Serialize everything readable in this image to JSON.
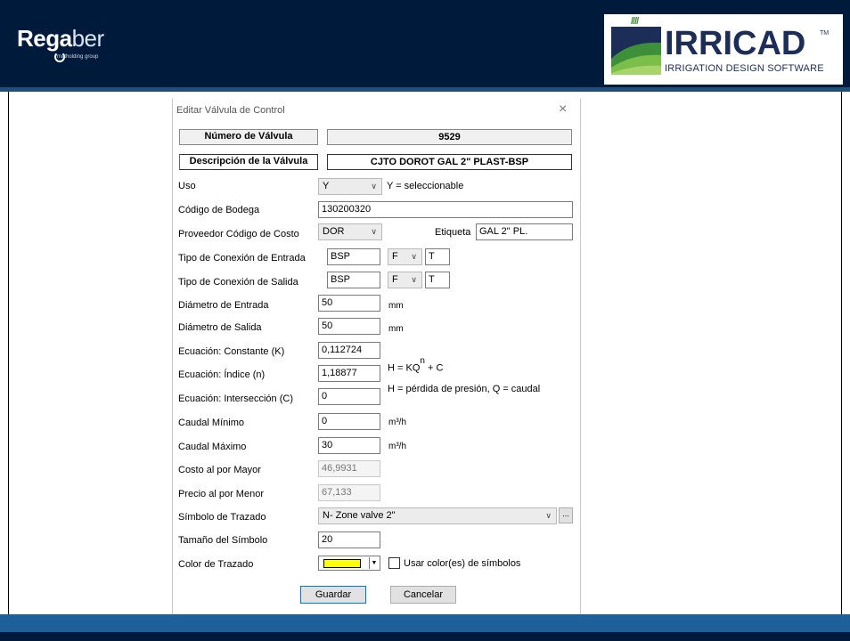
{
  "brand": {
    "left_logo_bold": "Rega",
    "left_logo_thin": "ber",
    "left_logo_sub": "matholding group",
    "right_logo_title": "IRRICAD",
    "right_logo_tm": "TM",
    "right_logo_sub": "IRRIGATION DESIGN SOFTWARE"
  },
  "dialog": {
    "title": "Editar Válvula de Control",
    "close_symbol": "×",
    "valve_number_label": "Número de Válvula",
    "valve_number_value": "9529",
    "description_label": "Descripción de la Válvula",
    "description_value": "CJTO DOROT GAL 2\" PLAST-BSP",
    "uso": {
      "label": "Uso",
      "value": "Y",
      "note": "Y = seleccionable"
    },
    "codigo_bodega": {
      "label": "Código de Bodega",
      "value": "130200320"
    },
    "proveedor": {
      "label": "Proveedor Código de Costo",
      "value": "DOR",
      "etiqueta_label": "Etiqueta",
      "etiqueta_value": "GAL 2\" PL."
    },
    "conexion_entrada": {
      "label": "Tipo de Conexión de Entrada",
      "type": "BSP",
      "gender": "F",
      "extra": "T"
    },
    "conexion_salida": {
      "label": "Tipo de Conexión de Salida",
      "type": "BSP",
      "gender": "F",
      "extra": "T"
    },
    "diametro_entrada": {
      "label": "Diámetro de Entrada",
      "value": "50",
      "unit": "mm"
    },
    "diametro_salida": {
      "label": "Diámetro de Salida",
      "value": "50",
      "unit": "mm"
    },
    "ecuacion_constante": {
      "label": "Ecuación: Constante (K)",
      "value": "0,112724"
    },
    "ecuacion_indice": {
      "label": "Ecuación: Índice (n)",
      "value": "1,18877"
    },
    "ecuacion_interseccion": {
      "label": "Ecuación: Intersección (C)",
      "value": "0"
    },
    "formula_a": "H = KQ",
    "formula_exp": "n",
    "formula_b": "+ C",
    "formula_legend": "H = pérdida de presión, Q = caudal",
    "caudal_minimo": {
      "label": "Caudal Mínimo",
      "value": "0",
      "unit": "m³/h"
    },
    "caudal_maximo": {
      "label": "Caudal Máximo",
      "value": "30",
      "unit": "m³/h"
    },
    "costo_mayor": {
      "label": "Costo al por Mayor",
      "value": "46,9931"
    },
    "precio_menor": {
      "label": "Precio al por Menor",
      "value": "67,133"
    },
    "simbolo_trazado": {
      "label": "Símbolo de Trazado",
      "value": "N- Zone valve 2\"",
      "browse": "..."
    },
    "tamano_simbolo": {
      "label": "Tamaño del Símbolo",
      "value": "20"
    },
    "color_trazado": {
      "label": "Color de Trazado",
      "swatch_color": "#ffff00",
      "checkbox_label": "Usar color(es) de símbolos",
      "checked": false
    },
    "buttons": {
      "save": "Guardar",
      "cancel": "Cancelar"
    }
  },
  "colors": {
    "header_band": "#001a3c",
    "stripe": "#1f5f9a",
    "irricad_navy": "#1c2d57",
    "irricad_green": "#3d8f3a"
  }
}
